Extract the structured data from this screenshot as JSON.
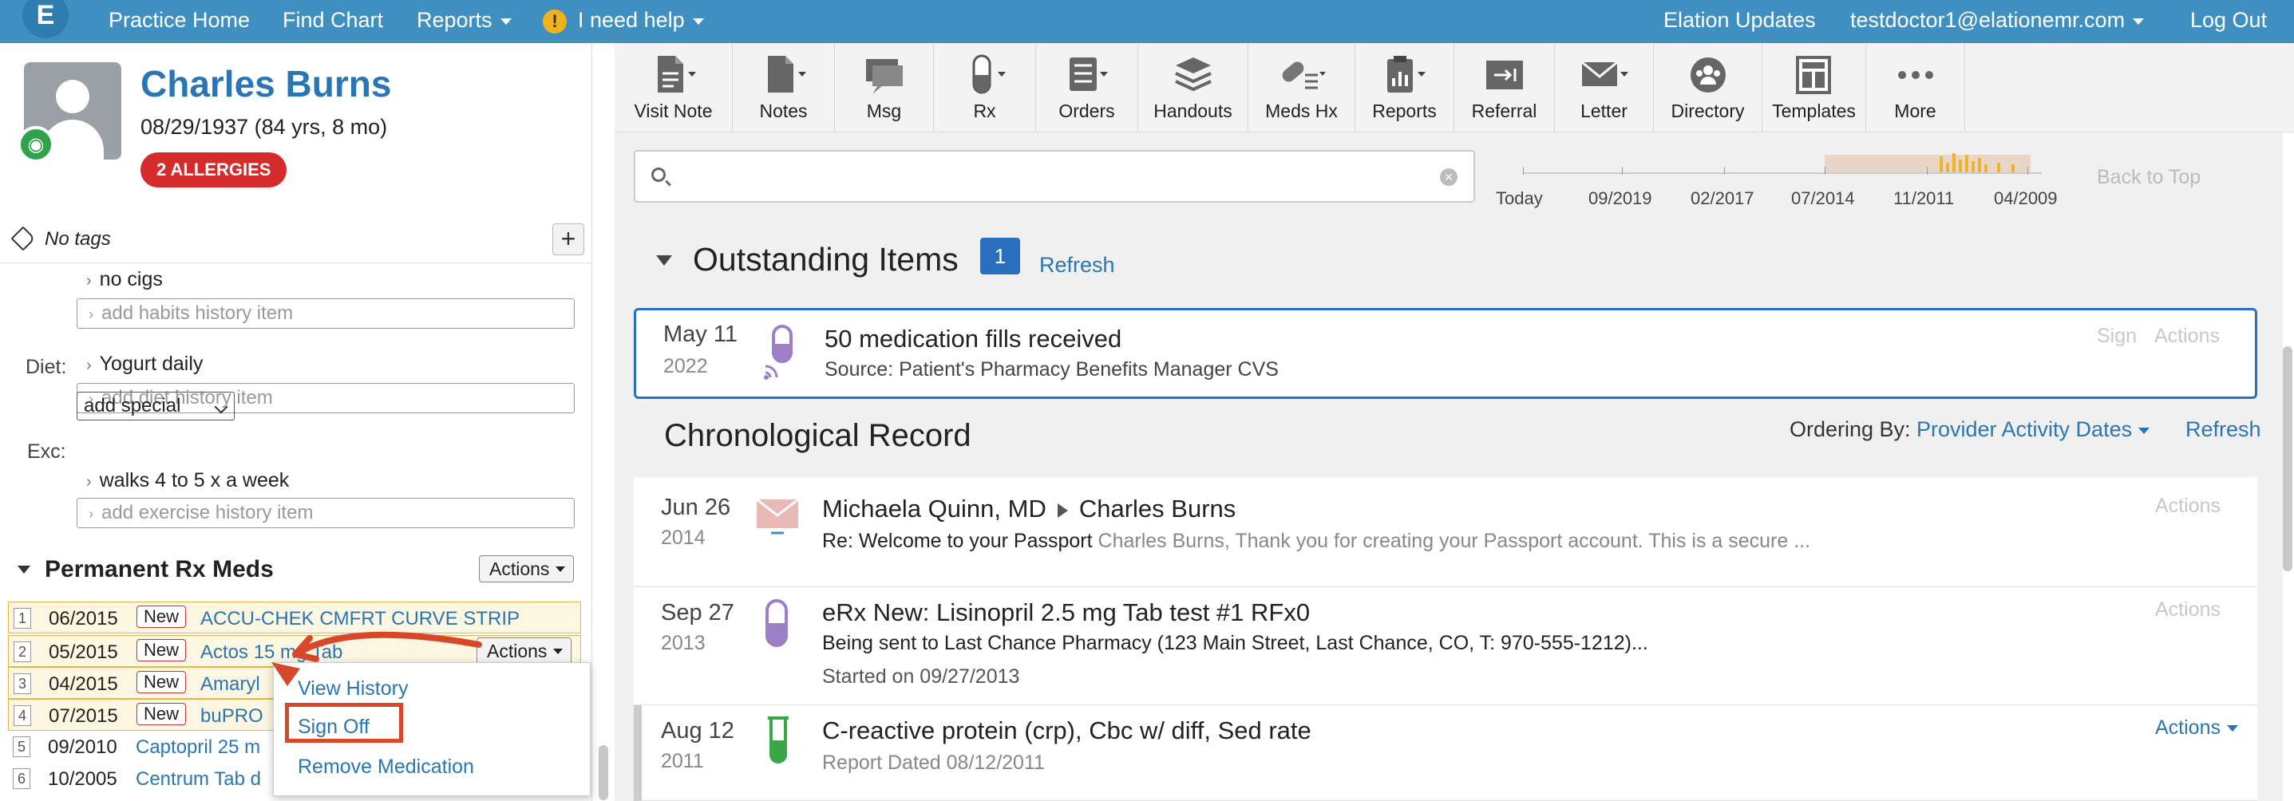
{
  "nav": {
    "logo_letter": "E",
    "practice_home": "Practice Home",
    "find_chart": "Find Chart",
    "reports": "Reports",
    "help_icon": "!",
    "help": "I need help",
    "updates": "Elation Updates",
    "user": "testdoctor1@elationemr.com",
    "logout": "Log Out"
  },
  "patient": {
    "name": "Charles Burns",
    "dob": "08/29/1937 (84 yrs, 8 mo)",
    "allergies": "2 ALLERGIES",
    "no_tags": "No tags",
    "add_tag": "+"
  },
  "history": {
    "habits_item": "no cigs",
    "habits_placeholder": "add habits history item",
    "diet_label": "Diet:",
    "diet_item": "Yogurt daily",
    "diet_placeholder": "add diet history item",
    "exc_label": "Exc:",
    "exc_select": "add special",
    "exc_item": "walks 4 to 5 x a week",
    "exc_placeholder": "add exercise history item",
    "chev": "›"
  },
  "rx": {
    "title": "Permanent Rx Meds",
    "actions": "Actions",
    "row_actions": "Actions",
    "new_label": "New",
    "meds": [
      {
        "num": "1",
        "date": "06/2015",
        "name": "ACCU-CHEK CMFRT CURVE STRIP"
      },
      {
        "num": "2",
        "date": "05/2015",
        "name": "Actos 15 mg Tab"
      },
      {
        "num": "3",
        "date": "04/2015",
        "name": "Amaryl"
      },
      {
        "num": "4",
        "date": "07/2015",
        "name": "buPRO"
      },
      {
        "num": "5",
        "date": "09/2010",
        "name": "Captopril 25 m"
      },
      {
        "num": "6",
        "date": "10/2005",
        "name": "Centrum Tab d"
      }
    ],
    "menu": {
      "view_history": "View History",
      "sign_off": "Sign Off",
      "remove": "Remove Medication"
    }
  },
  "toolbar": {
    "visit_note": "Visit Note",
    "notes": "Notes",
    "msg": "Msg",
    "rx": "Rx",
    "orders": "Orders",
    "handouts": "Handouts",
    "meds_hx": "Meds Hx",
    "reports": "Reports",
    "referral": "Referral",
    "letter": "Letter",
    "directory": "Directory",
    "templates": "Templates",
    "more": "More"
  },
  "timeline": {
    "labels": [
      "Today",
      "09/2019",
      "02/2017",
      "07/2014",
      "11/2011",
      "04/2009"
    ],
    "back_to_top": "Back to Top"
  },
  "outstanding": {
    "title": "Outstanding Items",
    "count": "1",
    "refresh": "Refresh",
    "item": {
      "date": "May 11",
      "year": "2022",
      "title": "50 medication fills received",
      "source": "Source: Patient's Pharmacy Benefits Manager CVS",
      "sign": "Sign",
      "actions": "Actions"
    }
  },
  "chrono": {
    "title": "Chronological Record",
    "ordering_label": "Ordering By:",
    "ordering_value": "Provider Activity Dates",
    "refresh": "Refresh",
    "items": [
      {
        "date": "Jun 26",
        "year": "2014",
        "from": "Michaela Quinn, MD",
        "to": "Charles Burns",
        "subject": "Re: Welcome to your Passport",
        "preview": "Charles Burns, Thank you for creating your Passport account. This is a secure ...",
        "actions": "Actions"
      },
      {
        "date": "Sep 27",
        "year": "2013",
        "title": "eRx New: Lisinopril 2.5 mg Tab test #1 RFx0",
        "line2": "Being sent to Last Chance Pharmacy (123 Main Street, Last Chance, CO, T: 970-555-1212)...",
        "line3": "Started on 09/27/2013",
        "actions": "Actions"
      },
      {
        "date": "Aug 12",
        "year": "2011",
        "title": "C-reactive protein (crp), Cbc w/ diff, Sed rate",
        "line2": "Report Dated 08/12/2011",
        "actions": "Actions"
      }
    ]
  },
  "colors": {
    "nav": "#3f8fc0",
    "link": "#2a76b5",
    "allergy": "#d62b2b",
    "highlight": "#d9472b",
    "med_purple": "#9b7fc7",
    "lab_green": "#3ba54a"
  }
}
